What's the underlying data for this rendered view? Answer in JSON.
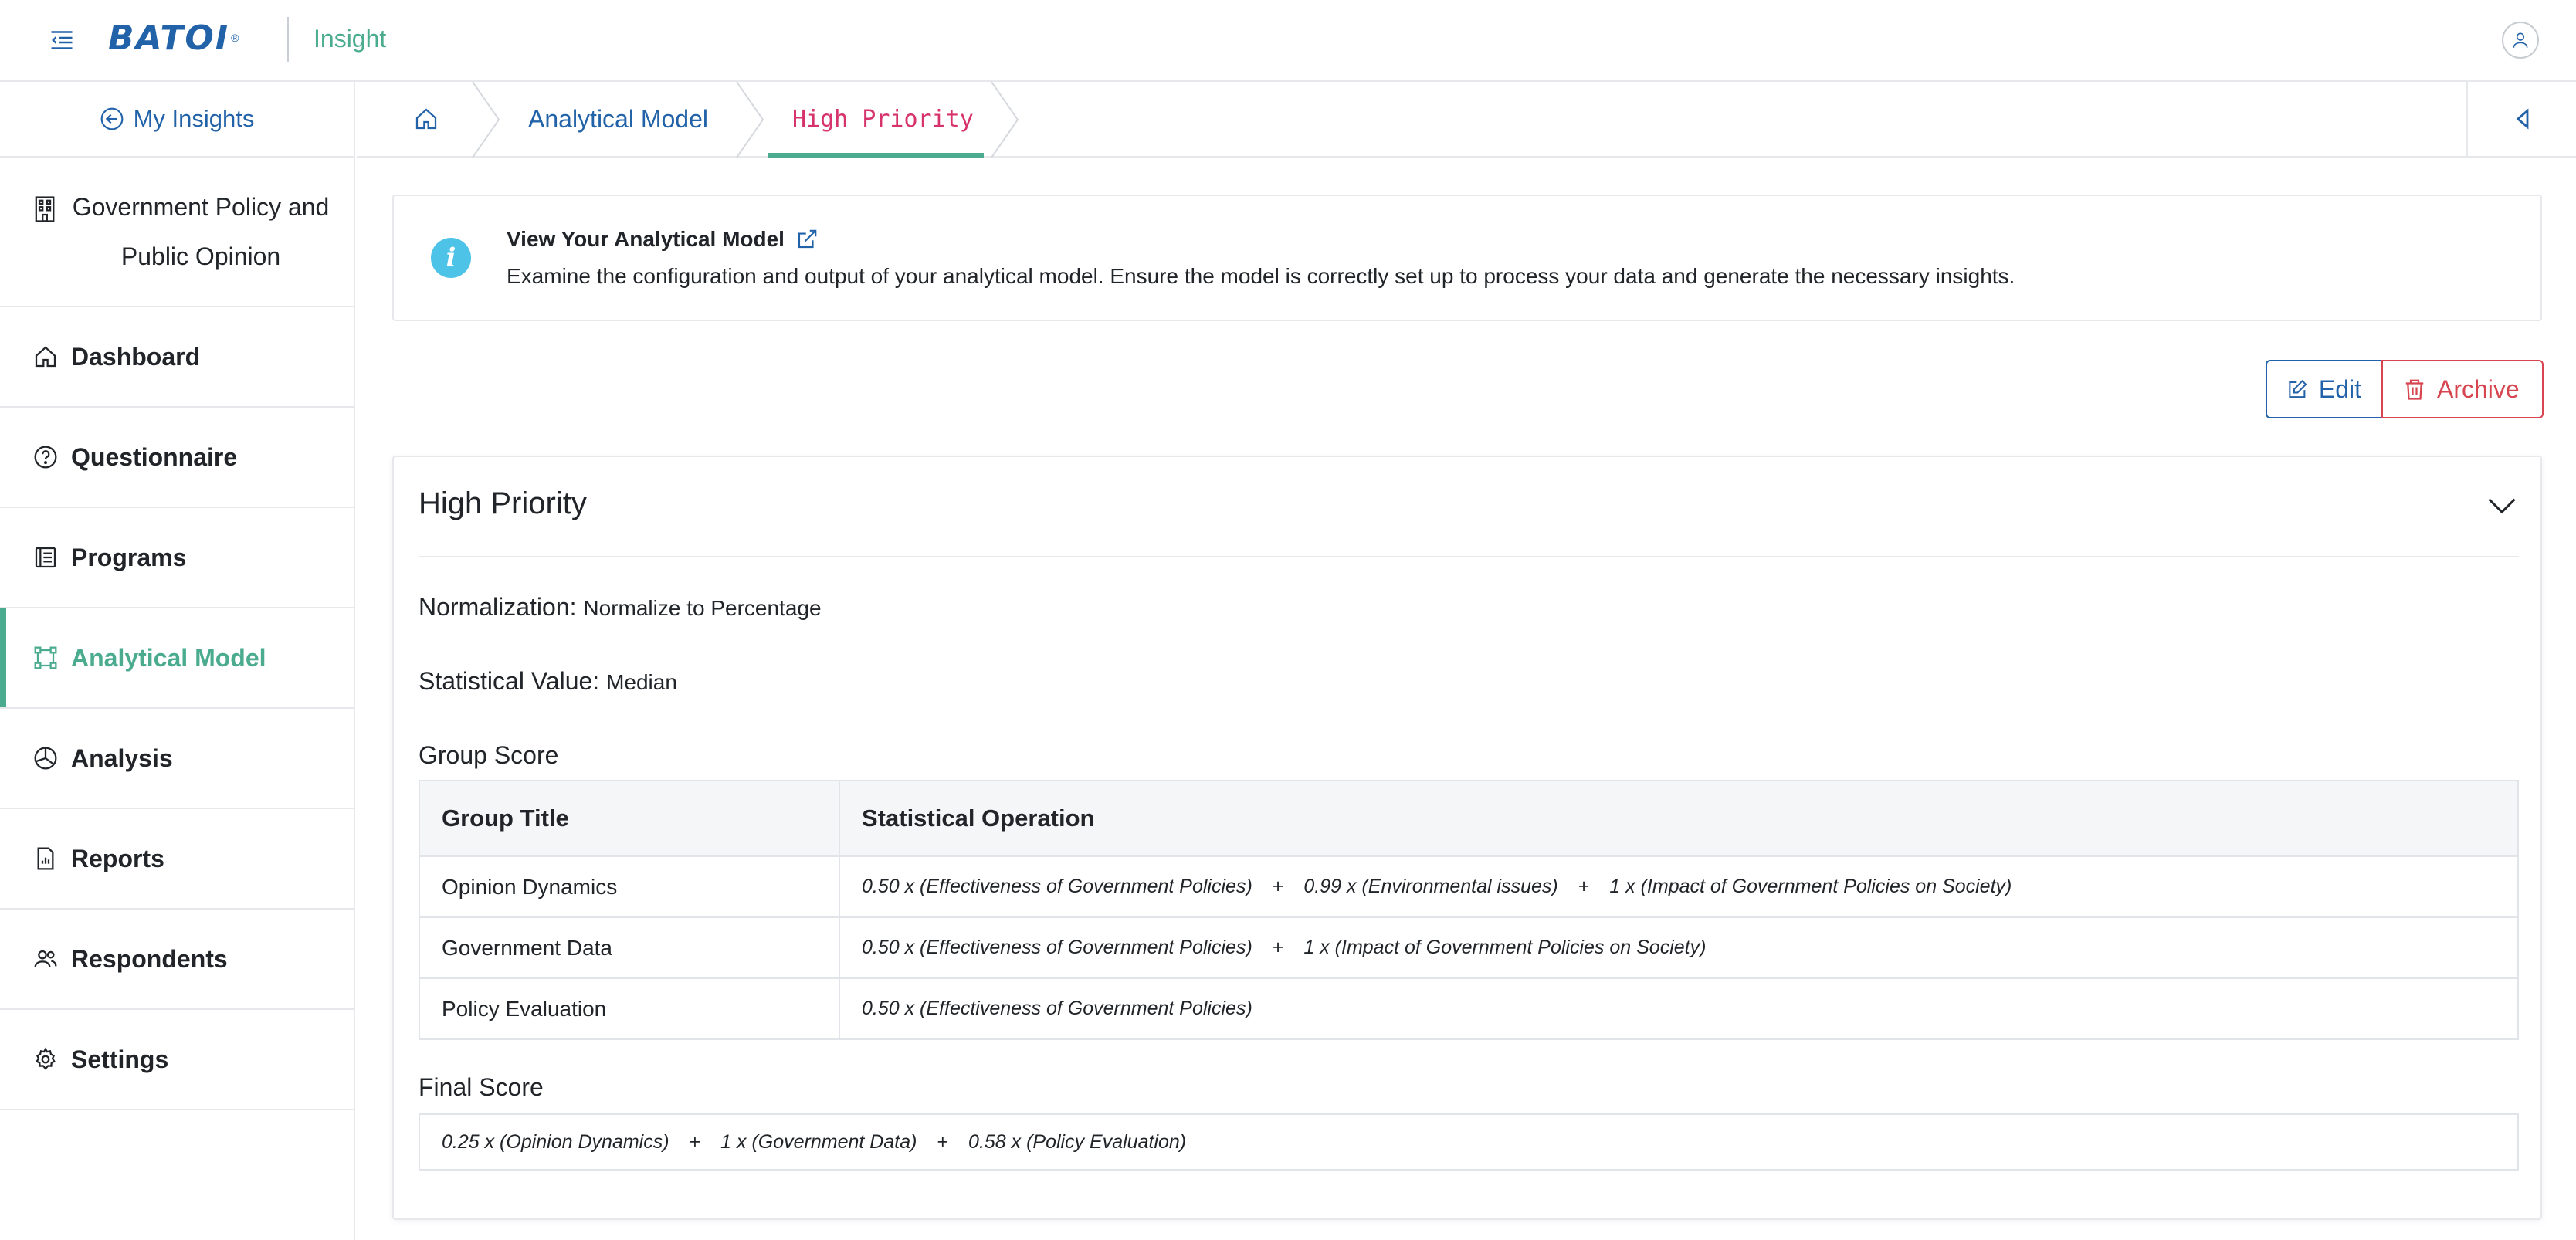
{
  "header": {
    "logo_text": "BATOI",
    "app_name": "Insight"
  },
  "sidebar": {
    "back_label": "My Insights",
    "project_name": "Government Policy and Public Opinion",
    "items": [
      {
        "label": "Dashboard",
        "icon": "home-icon"
      },
      {
        "label": "Questionnaire",
        "icon": "question-circle-icon"
      },
      {
        "label": "Programs",
        "icon": "list-icon"
      },
      {
        "label": "Analytical Model",
        "icon": "model-icon",
        "active": true
      },
      {
        "label": "Analysis",
        "icon": "pie-chart-icon"
      },
      {
        "label": "Reports",
        "icon": "report-icon"
      },
      {
        "label": "Respondents",
        "icon": "users-icon"
      },
      {
        "label": "Settings",
        "icon": "gear-icon"
      }
    ]
  },
  "breadcrumb": {
    "items": [
      "Analytical Model",
      "High Priority"
    ]
  },
  "info": {
    "title": "View Your Analytical Model",
    "description": "Examine the configuration and output of your analytical model. Ensure the model is correctly set up to process your data and generate the necessary insights."
  },
  "actions": {
    "edit_label": "Edit",
    "archive_label": "Archive"
  },
  "model": {
    "title": "High Priority",
    "normalization_label": "Normalization:",
    "normalization_value": "Normalize to Percentage",
    "statistical_label": "Statistical Value:",
    "statistical_value": "Median",
    "group_score_label": "Group Score",
    "table_headers": [
      "Group Title",
      "Statistical Operation"
    ],
    "groups": [
      {
        "title": "Opinion Dynamics",
        "terms": [
          "0.50 x (Effectiveness of Government Policies)",
          "0.99 x (Environmental issues)",
          "1 x (Impact of Government Policies on Society)"
        ]
      },
      {
        "title": "Government Data",
        "terms": [
          "0.50 x (Effectiveness of Government Policies)",
          "1 x (Impact of Government Policies on Society)"
        ]
      },
      {
        "title": "Policy Evaluation",
        "terms": [
          "0.50 x (Effectiveness of Government Policies)"
        ]
      }
    ],
    "final_score_label": "Final Score",
    "final_terms": [
      "0.25 x (Opinion Dynamics)",
      "1 x (Government Data)",
      "0.58 x (Policy Evaluation)"
    ],
    "operator": "+"
  },
  "colors": {
    "primary": "#2262a8",
    "accent": "#4aab8f",
    "danger": "#d64550",
    "breadcrumb_current": "#d6336c",
    "info": "#4dc3e8"
  }
}
